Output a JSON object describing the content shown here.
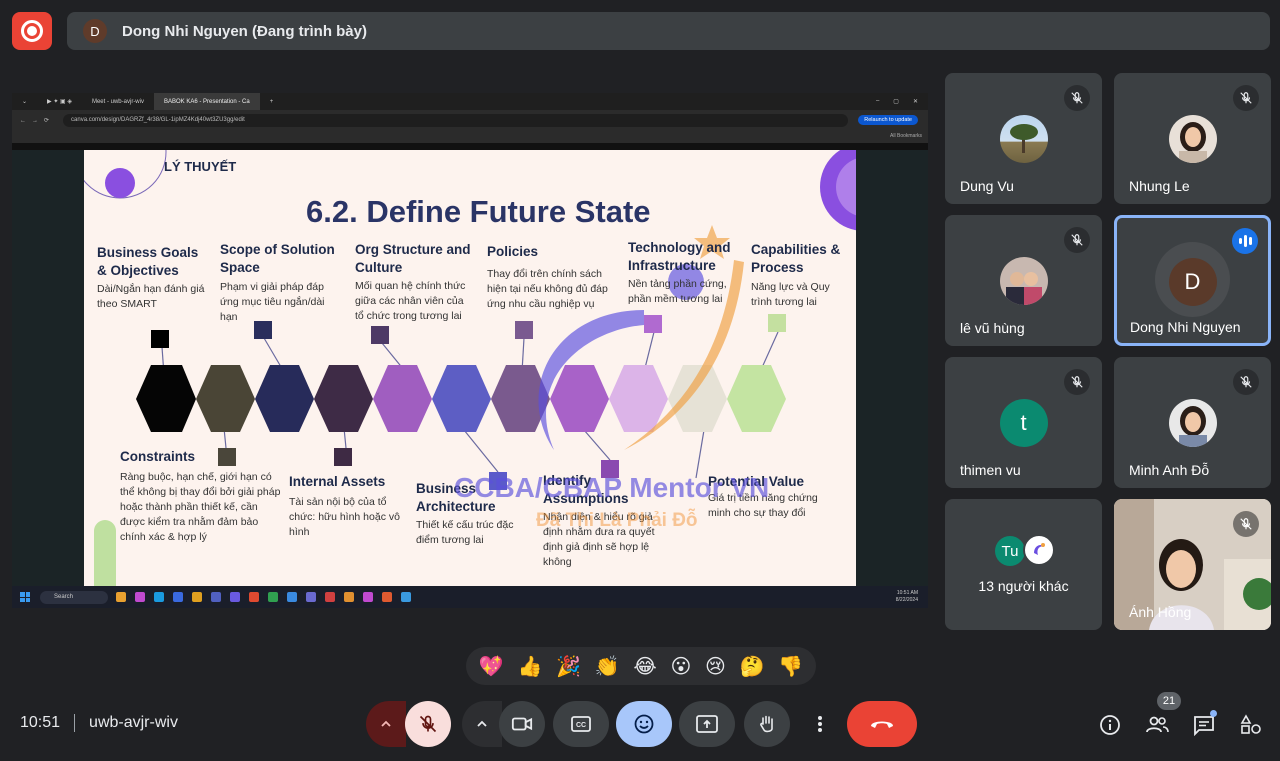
{
  "presenter": {
    "initial": "D",
    "label": "Dong Nhi Nguyen (Đang trình bày)"
  },
  "browser": {
    "tabs": [
      "Meet - uwb-avjr-wiv",
      "BABOK KA6 - Presentation - Ca"
    ],
    "url": "canva.com/design/DAGRZf_4r38/GL-1ipMZ4Kdj40wt3ZU3gg/edit",
    "relaunch": "Relaunch to update",
    "bookmarks": "All Bookmarks"
  },
  "taskbar": {
    "search": "Search",
    "time": "10:51 AM",
    "date": "8/22/2024"
  },
  "slide": {
    "section": "LÝ THUYẾT",
    "title": "6.2. Define Future State",
    "items": [
      {
        "label": "Business Goals & Objectives",
        "desc": "Dài/Ngắn hạn đánh giá theo SMART"
      },
      {
        "label": "Scope of Solution Space",
        "desc": "Phạm vi giải pháp đáp ứng mục tiêu ngắn/dài hạn"
      },
      {
        "label": "Org Structure and Culture",
        "desc": "Mối quan hệ chính thức giữa các nhân viên của tổ chức trong tương lai"
      },
      {
        "label": "Policies",
        "desc": "Thay đổi trên chính sách hiện tại nếu không đủ đáp ứng nhu cầu nghiệp vụ"
      },
      {
        "label": "Technology and Infrastructure",
        "desc": "Nền tảng phần cứng, phần mềm tương lai"
      },
      {
        "label": "Capabilities & Process",
        "desc": "Năng lực và Quy trình tương lai"
      },
      {
        "label": "Constraints",
        "desc": "Ràng buộc, hạn chế, giới hạn có thể không bị thay đổi bởi giải pháp hoặc thành phần thiết kế, cần được kiểm tra nhằm đảm bảo chính xác & hợp lý"
      },
      {
        "label": "Internal Assets",
        "desc": "Tài sản nội bộ của tổ chức: hữu hình hoặc vô hình"
      },
      {
        "label": "Business Architecture",
        "desc": "Thiết kế cấu trúc đặc điểm tương lai"
      },
      {
        "label": "Identify Assumptions",
        "desc": "Nhận diện & hiểu rõ giả định nhằm đưa ra quyết định giả định sẽ hợp lệ không"
      },
      {
        "label": "Potential Value",
        "desc": "Giá trị tiềm năng chứng minh cho sự thay đổi"
      }
    ],
    "watermark": "CCBA/CBAP Mentor VN",
    "watermark_sub": "Đã Thi Là Phải Đỗ"
  },
  "participants": [
    {
      "name": "Dung Vu"
    },
    {
      "name": "Nhung Le"
    },
    {
      "name": "lê vũ hùng"
    },
    {
      "name": "Dong Nhi Nguyen",
      "initial": "D"
    },
    {
      "name": "thimen vu",
      "initial": "t"
    },
    {
      "name": "Minh Anh Đỗ"
    },
    {
      "name": "13 người khác",
      "initial": "Tu"
    },
    {
      "name": "Ánh Hồng"
    }
  ],
  "reactions": [
    "💖",
    "👍",
    "🎉",
    "👏",
    "😂",
    "😮",
    "😢",
    "🤔",
    "👎"
  ],
  "meeting": {
    "time": "10:51",
    "code": "uwb-avjr-wiv",
    "participant_count": "21"
  },
  "colors": {
    "accent": "#8ab4f8",
    "end_call": "#ea4335",
    "reaction_active": "#a8c7fa",
    "mic_off": "#f9dedc"
  }
}
